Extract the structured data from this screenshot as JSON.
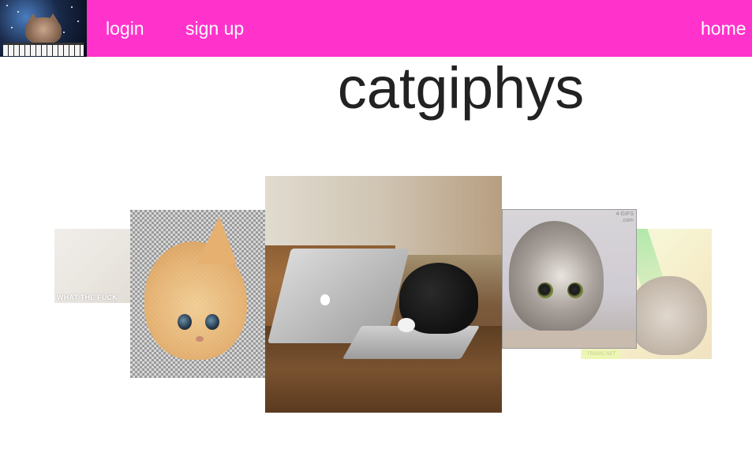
{
  "navbar": {
    "logo": "keyboard-cat-logo",
    "links": {
      "login": "login",
      "signup": "sign up",
      "home": "home"
    },
    "background_color": "#ff33cc"
  },
  "site": {
    "title": "catgiphys"
  },
  "carousel": {
    "slides": [
      {
        "id": "gif-1",
        "caption": "WHAT THE FUCK"
      },
      {
        "id": "gif-2",
        "description": "orange cat illusion"
      },
      {
        "id": "gif-3",
        "description": "black cat typing on laptop",
        "active": true
      },
      {
        "id": "gif-4",
        "description": "tabby cat crouching",
        "watermark": "4-GIFS\n.com"
      },
      {
        "id": "gif-5",
        "description": "cat with laser eyes",
        "tag": "TRAGIC.NET"
      }
    ]
  }
}
